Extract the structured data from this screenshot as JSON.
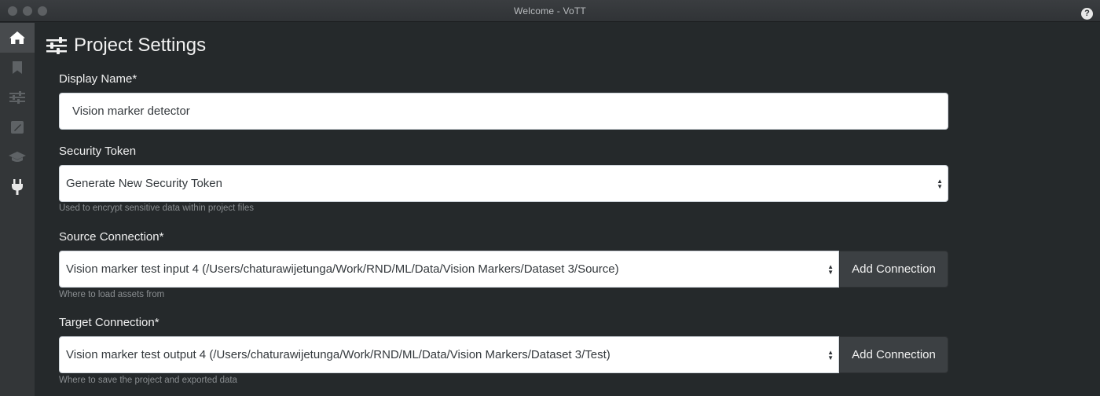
{
  "window": {
    "title": "Welcome - VoTT",
    "help_label": "?"
  },
  "sidebar": {
    "items": [
      {
        "icon": "home-icon",
        "active": true
      },
      {
        "icon": "bookmark-icon",
        "active": false
      },
      {
        "icon": "sliders-icon",
        "active": false
      },
      {
        "icon": "edit-image-icon",
        "active": false
      },
      {
        "icon": "graduation-cap-icon",
        "active": false
      },
      {
        "icon": "plug-icon",
        "active": false
      }
    ]
  },
  "page": {
    "title": "Project Settings",
    "icon": "sliders-icon"
  },
  "form": {
    "display_name": {
      "label": "Display Name*",
      "value": "Vision marker detector"
    },
    "security_token": {
      "label": "Security Token",
      "value": "Generate New Security Token",
      "help": "Used to encrypt sensitive data within project files"
    },
    "source_connection": {
      "label": "Source Connection*",
      "value": "Vision marker test input 4 (/Users/chaturawijetunga/Work/RND/ML/Data/Vision Markers/Dataset 3/Source)",
      "button": "Add Connection",
      "help": "Where to load assets from"
    },
    "target_connection": {
      "label": "Target Connection*",
      "value": "Vision marker test output 4 (/Users/chaturawijetunga/Work/RND/ML/Data/Vision Markers/Dataset 3/Test)",
      "button": "Add Connection",
      "help": "Where to save the project and exported data"
    }
  }
}
